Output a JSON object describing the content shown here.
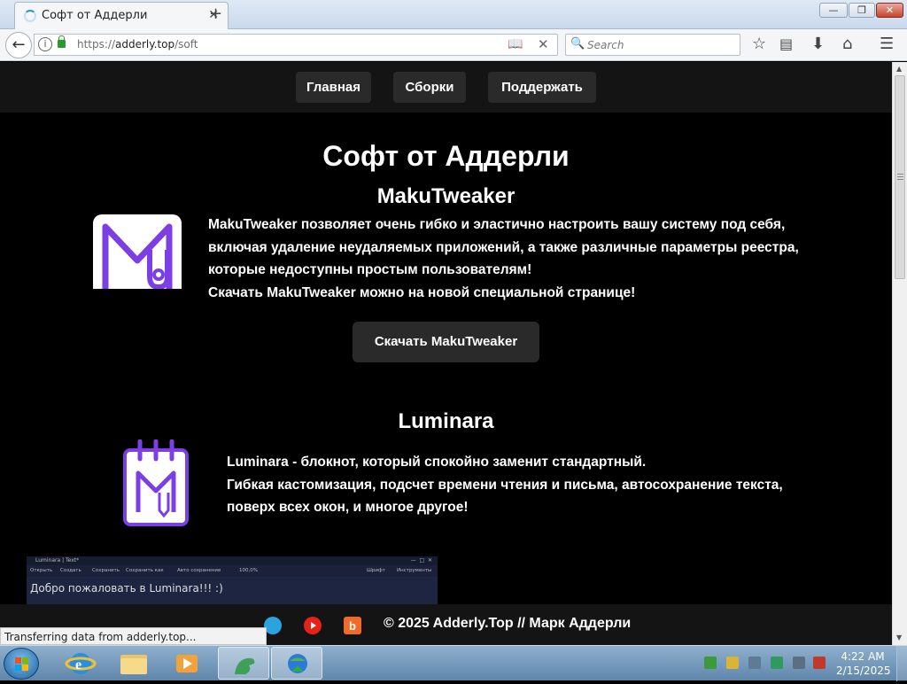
{
  "browser": {
    "tab_title": "Софт от Аддерли",
    "url_scheme": "https://",
    "url_host": "adderly.top",
    "url_path": "/soft",
    "search_placeholder": "Search",
    "status_text": "Transferring data from adderly.top...",
    "tab_close": "✕",
    "new_tab": "+"
  },
  "site": {
    "nav": [
      "Главная",
      "Сборки",
      "Поддержать"
    ],
    "page_title": "Софт от Аддерли",
    "products": [
      {
        "name": "MakuTweaker",
        "lines": [
          "MakuTweaker позволяет очень гибко и эластично настроить вашу систему под себя,",
          "включая удаление неудаляемых приложений, а также различные параметры реестра,",
          "которые недоступны простым пользователям!",
          "Скачать MakuTweaker можно на новой специальной странице!"
        ],
        "button": "Скачать MakuTweaker"
      },
      {
        "name": "Luminara",
        "lines": [
          "Luminara - блокнот, который спокойно заменит стандартный.",
          "Гибкая кастомизация, подсчет времени чтения и письма, автосохранение текста,",
          "поверх всех окон, и многое другое!"
        ]
      }
    ],
    "screenshot": {
      "window_title": "Luminara | Text*",
      "toolbar": [
        "Открыть",
        "Создать",
        "Сохранить",
        "Сохранить как",
        "Авто сохранение",
        "100,0%",
        "Шрифт",
        "Инструменты"
      ],
      "text": "Добро пожаловать в Luminara!!! :)"
    },
    "footer": "© 2025 Adderly.Top // Марк Аддерли"
  },
  "taskbar": {
    "time": "4:22 AM",
    "date": "2/15/2025"
  },
  "colors": {
    "accent_purple": "#7b3fe4",
    "page_bg": "#000000",
    "header_bg": "#141414",
    "button_bg": "#2a2a2a"
  }
}
